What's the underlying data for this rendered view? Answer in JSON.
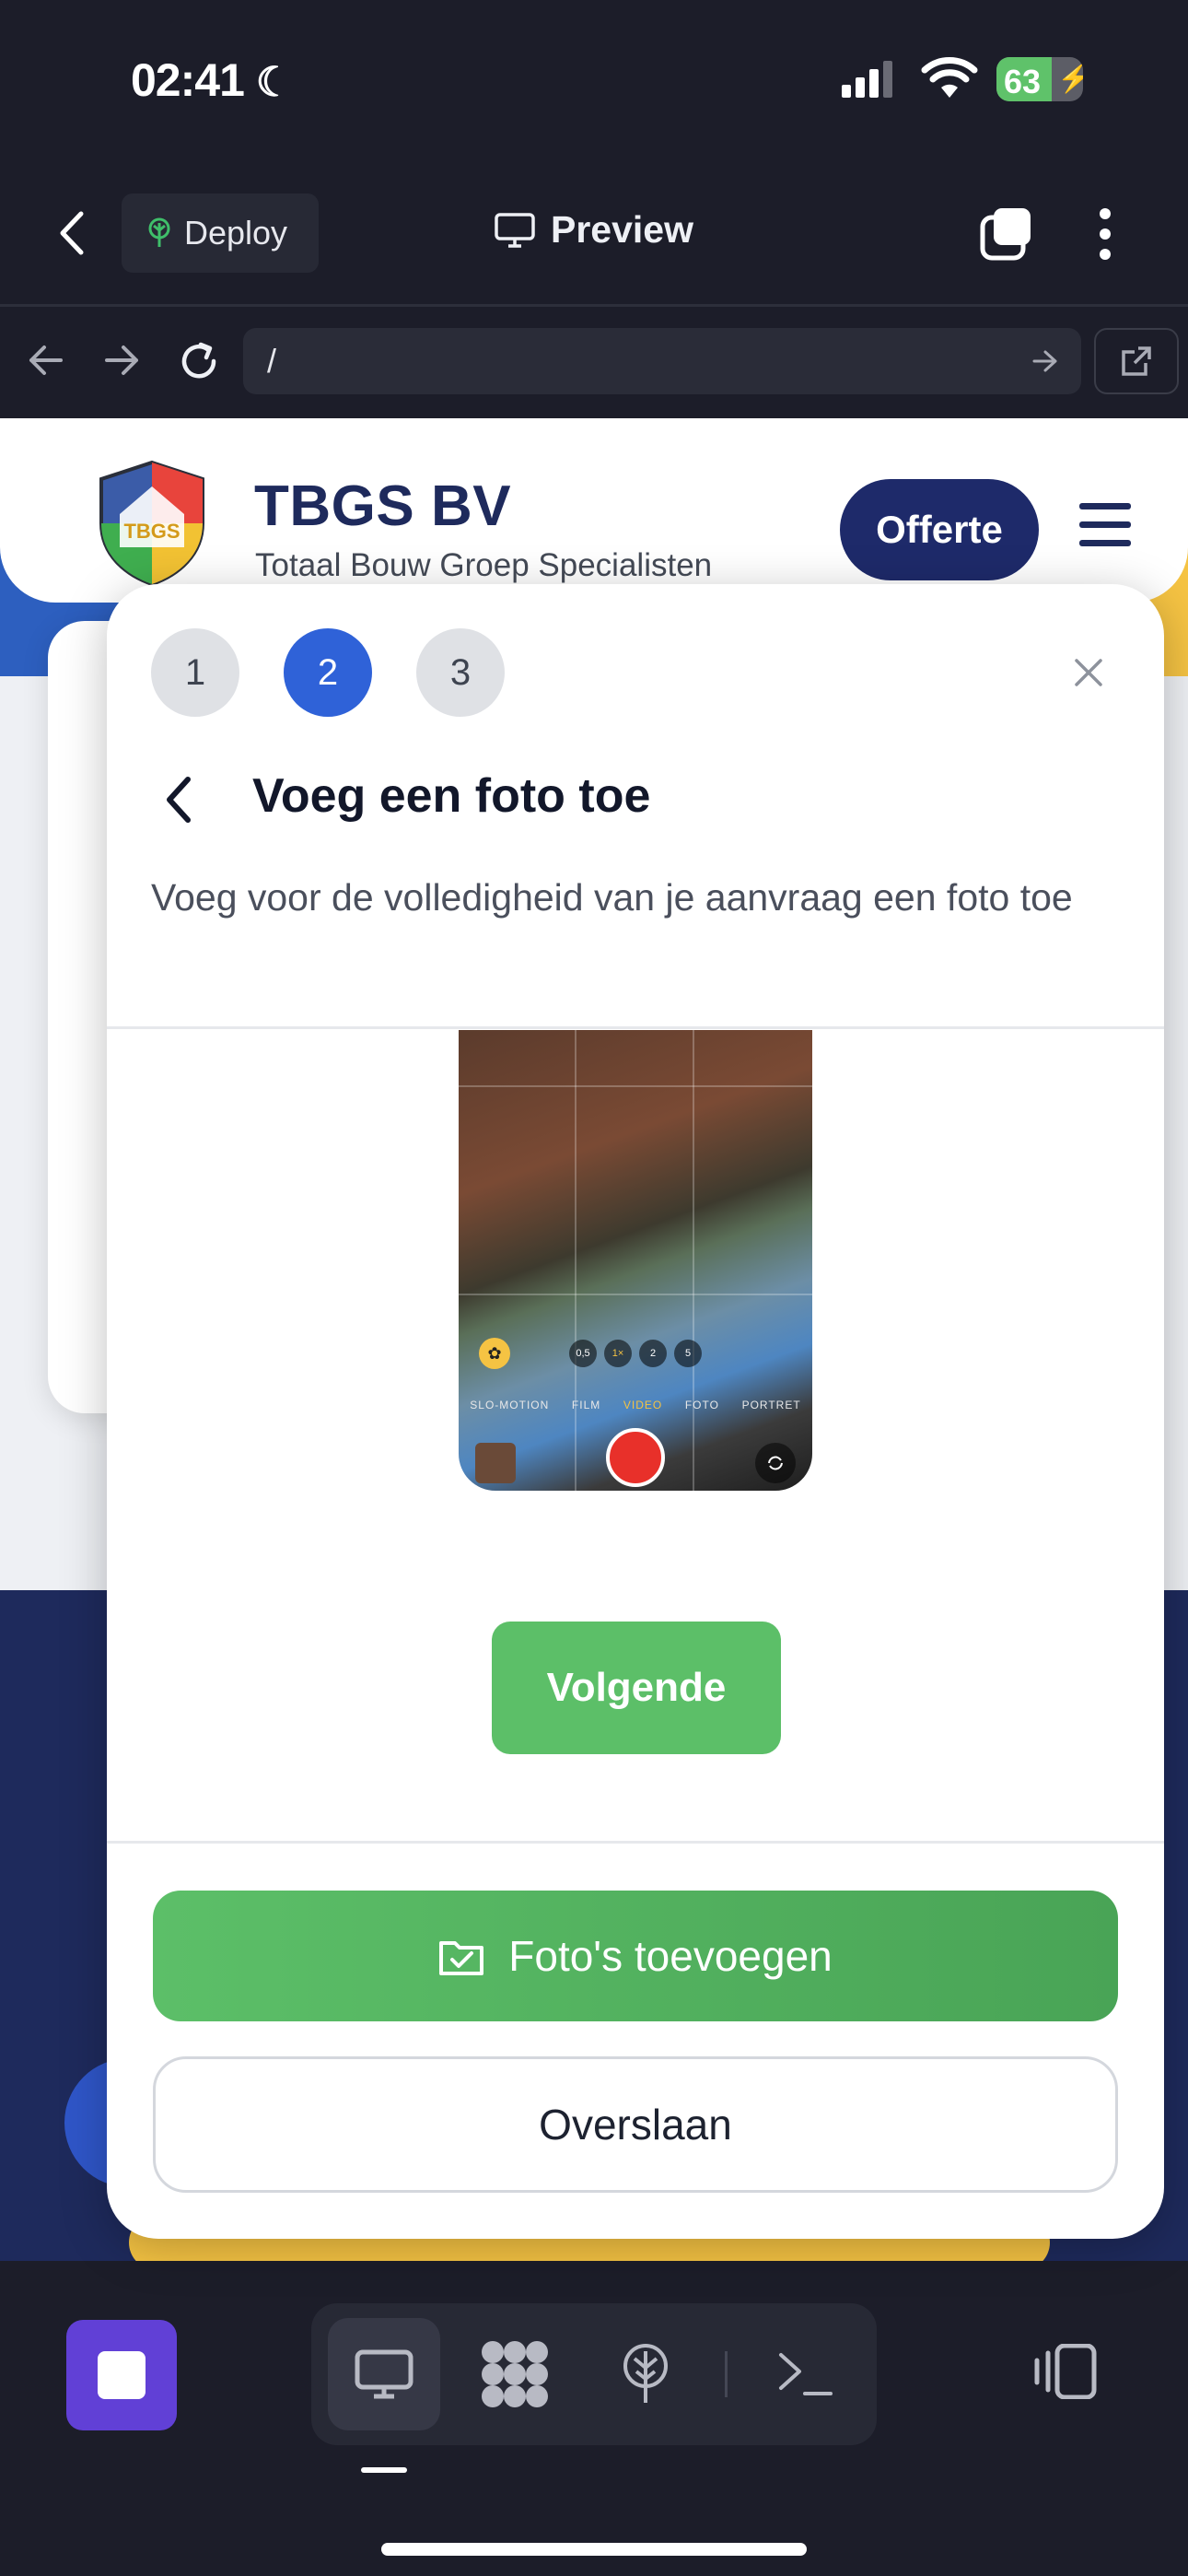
{
  "status_bar": {
    "time": "02:41",
    "battery": "63"
  },
  "topbar": {
    "deploy_label": "Deploy",
    "preview_label": "Preview"
  },
  "urlbar": {
    "url": "/"
  },
  "site": {
    "brand": "TBGS BV",
    "tagline": "Totaal Bouw Groep Specialisten",
    "cta": "Offerte",
    "logo_text": "TBGS"
  },
  "modal": {
    "steps": [
      "1",
      "2",
      "3"
    ],
    "active_step": "2",
    "title": "Voeg een foto toe",
    "description": "Voeg voor de volledigheid van je aanvraag een foto toe",
    "camera": {
      "zoom": [
        "0,5",
        "1×",
        "2",
        "5"
      ],
      "modes": [
        "SLO-MOTION",
        "FILM",
        "VIDEO",
        "FOTO",
        "PORTRET"
      ]
    },
    "next_label": "Volgende",
    "add_photos_label": "Foto's toevoegen",
    "skip_label": "Overslaan"
  },
  "colors": {
    "accent_blue": "#2f62d8",
    "brand_navy": "#1e2a6a",
    "green": "#5cbf68",
    "stop_purple": "#6140d6"
  }
}
